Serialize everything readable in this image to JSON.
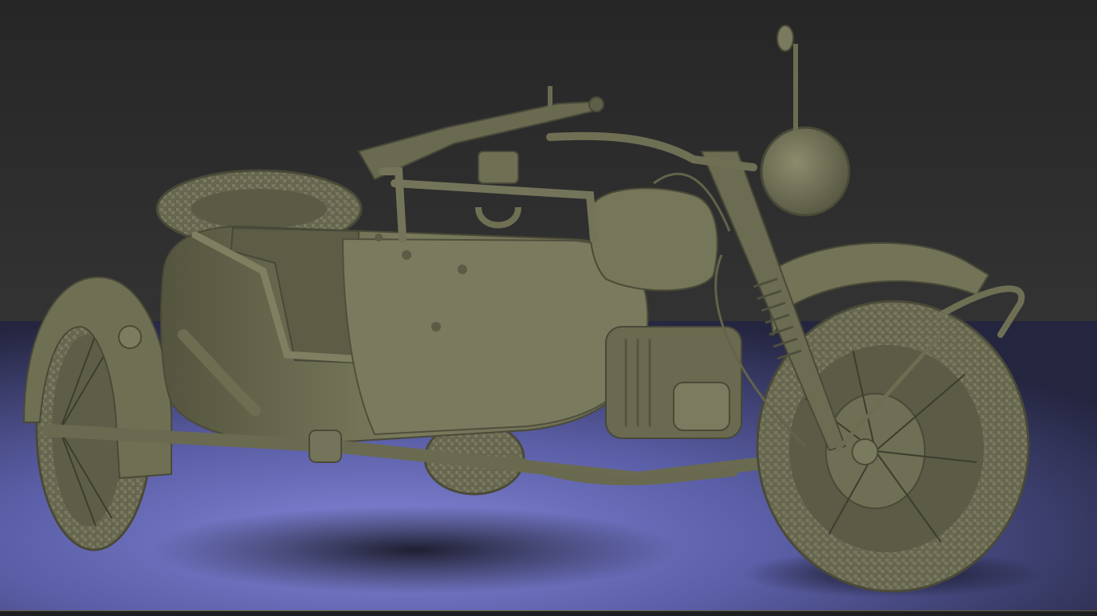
{
  "render": {
    "subject": "motorcycle-with-sidecar",
    "colors": {
      "backdrop": "#2b2b2b",
      "floor_light": "#7a7fd0",
      "floor_dark": "#23243e",
      "body": "#727256",
      "body_light": "#8e8e70",
      "body_dark": "#4d4d3a",
      "shadow": "#1c1c2a",
      "bottom_strip": "#1e1f22",
      "bottom_line": "#6b6033"
    }
  }
}
